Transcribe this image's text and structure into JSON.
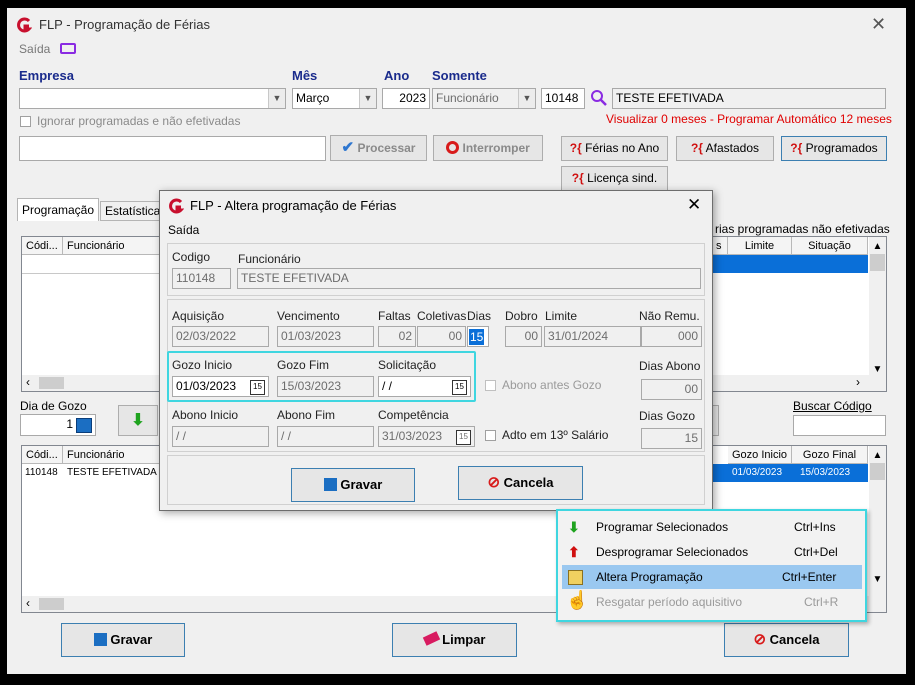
{
  "main": {
    "title": "FLP - Programação de Férias",
    "menu_saida": "Saída",
    "empresa_label": "Empresa",
    "mes_label": "Mês",
    "mes_value": "Março",
    "ano_label": "Ano",
    "ano_value": "2023",
    "somente_label": "Somente",
    "somente_value": "Funcionário",
    "code_value": "10148",
    "employee_name": "TESTE EFETIVADA",
    "ignorar_label": "Ignorar programadas e não efetivadas",
    "visualizar_text": "Visualizar 0 meses - Programar Automático 12 meses",
    "processar_label": "Processar",
    "interromper_label": "Interromper",
    "ferias_ano_label": "Férias no Ano",
    "afastados_label": "Afastados",
    "programados_label": "Programados",
    "licenca_label": "Licença sind.",
    "tab_programacao": "Programação",
    "tab_estatistica": "Estatística",
    "tab_right_text": "rias programadas não efetivadas",
    "grid1_cols": [
      "Códi...",
      "Funcionário"
    ],
    "grid1_right_cols": [
      "s",
      "Limite",
      "Situação"
    ],
    "dia_gozo_label": "Dia de Gozo",
    "dia_gozo_value": "1",
    "buscar_codigo_label": "Buscar Código",
    "grid2_cols": [
      "Códi...",
      "Funcionário"
    ],
    "grid2_right_cols": [
      "Gozo Inicio",
      "Gozo Final"
    ],
    "grid2_row": {
      "code": "110148",
      "name": "TESTE EFETIVADA",
      "gozo_inicio": "01/03/2023",
      "gozo_final": "15/03/2023"
    },
    "gravar_label": "Gravar",
    "limpar_label": "Limpar",
    "cancela_label": "Cancela"
  },
  "dialog": {
    "title": "FLP - Altera programação de Férias",
    "menu_saida": "Saída",
    "codigo_label": "Codigo",
    "codigo_value": "110148",
    "funcionario_label": "Funcionário",
    "funcionario_value": "TESTE EFETIVADA",
    "aquisicao_label": "Aquisição",
    "aquisicao_value": "02/03/2022",
    "vencimento_label": "Vencimento",
    "vencimento_value": "01/03/2023",
    "faltas_label": "Faltas",
    "faltas_value": "02",
    "coletivas_label": "Coletivas",
    "coletivas_value": "00",
    "dias_label": "Dias",
    "dias_value": "15",
    "dobro_label": "Dobro",
    "dobro_value": "00",
    "limite_label": "Limite",
    "limite_value": "31/01/2024",
    "nao_remu_label": "Não Remu.",
    "nao_remu_value": "000",
    "gozo_inicio_label": "Gozo Inicio",
    "gozo_inicio_value": "01/03/2023",
    "gozo_fim_label": "Gozo Fim",
    "gozo_fim_value": "15/03/2023",
    "solicitacao_label": "Solicitação",
    "solicitacao_value": " / /",
    "abono_antes_label": "Abono antes Gozo",
    "dias_abono_label": "Dias Abono",
    "dias_abono_value": "00",
    "abono_inicio_label": "Abono Inicio",
    "abono_inicio_value": " / /",
    "abono_fim_label": "Abono Fim",
    "abono_fim_value": " / /",
    "competencia_label": "Competência",
    "competencia_value": "31/03/2023",
    "adto_label": "Adto em 13º Salário",
    "dias_gozo_label": "Dias Gozo",
    "dias_gozo_value": "15",
    "gravar_label": "Gravar",
    "cancela_label": "Cancela"
  },
  "context_menu": [
    {
      "label": "Programar Selecionados",
      "shortcut": "Ctrl+Ins",
      "icon": "green-down-arrow-icon"
    },
    {
      "label": "Desprogramar Selecionados",
      "shortcut": "Ctrl+Del",
      "icon": "red-up-arrow-icon"
    },
    {
      "label": "Altera Programação",
      "shortcut": "Ctrl+Enter",
      "icon": "edit-document-icon"
    },
    {
      "label": "Resgatar período aquisitivo",
      "shortcut": "Ctrl+R",
      "icon": "hand-pointer-icon"
    }
  ],
  "colors": {
    "highlight_cyan": "#3fd6e0",
    "selection_blue": "#0a6fd8",
    "red_text": "#e00000",
    "label_blue": "#1a2b8c"
  }
}
